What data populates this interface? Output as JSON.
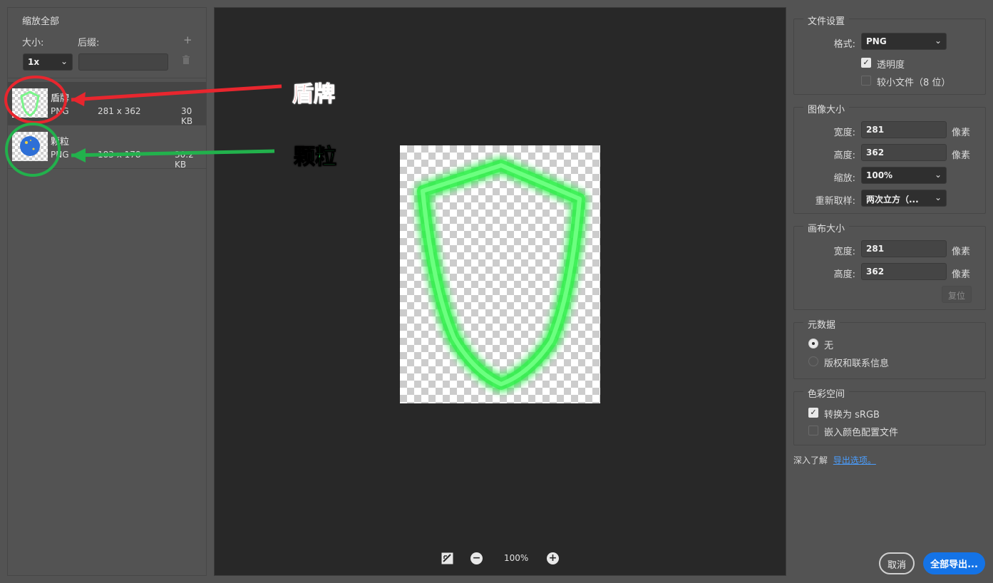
{
  "left": {
    "scale_all_title": "缩放全部",
    "size_label": "大小:",
    "suffix_label": "后缀:",
    "size_value": "1x",
    "suffix_value": "",
    "add_icon": "plus-icon",
    "delete_icon": "trash-icon",
    "assets": [
      {
        "name": "盾牌",
        "format": "PNG",
        "dims": "281 x 362",
        "size": "30 KB"
      },
      {
        "name": "颗粒",
        "format": "PNG",
        "dims": "183 x 178",
        "size": "30.2 KB"
      }
    ]
  },
  "annotations": {
    "shield_label": "盾牌",
    "particle_label": "颗粒",
    "shield_color": "#e8262e",
    "particle_color": "#22b14c"
  },
  "preview": {
    "zoom": "100%",
    "toggle_icon": "fit-toggle-icon",
    "zoom_out_icon": "zoom-out-icon",
    "zoom_in_icon": "zoom-in-icon"
  },
  "file_settings": {
    "title": "文件设置",
    "format_label": "格式:",
    "format_value": "PNG",
    "transparency_label": "透明度",
    "transparency_checked": true,
    "smaller_file_label": "较小文件（8 位）",
    "smaller_file_checked": false
  },
  "image_size": {
    "title": "图像大小",
    "width_label": "宽度:",
    "width_value": "281",
    "height_label": "高度:",
    "height_value": "362",
    "scale_label": "缩放:",
    "scale_value": "100%",
    "resample_label": "重新取样:",
    "resample_value": "两次立方（...",
    "unit": "像素"
  },
  "canvas_size": {
    "title": "画布大小",
    "width_label": "宽度:",
    "width_value": "281",
    "height_label": "高度:",
    "height_value": "362",
    "unit": "像素",
    "reset_label": "复位"
  },
  "metadata": {
    "title": "元数据",
    "option_none": "无",
    "option_copyright": "版权和联系信息",
    "selected": "无"
  },
  "color_space": {
    "title": "色彩空间",
    "convert_label": "转换为 sRGB",
    "convert_checked": true,
    "embed_label": "嵌入颜色配置文件",
    "embed_checked": false
  },
  "footer": {
    "learn_more": "深入了解",
    "export_options_link": "导出选项。",
    "cancel_label": "取消",
    "export_all_label": "全部导出..."
  },
  "colors": {
    "accent": "#1473e6",
    "panel_bg": "#535353",
    "preview_bg": "#282828",
    "shield_glow": "#2ef04a"
  }
}
